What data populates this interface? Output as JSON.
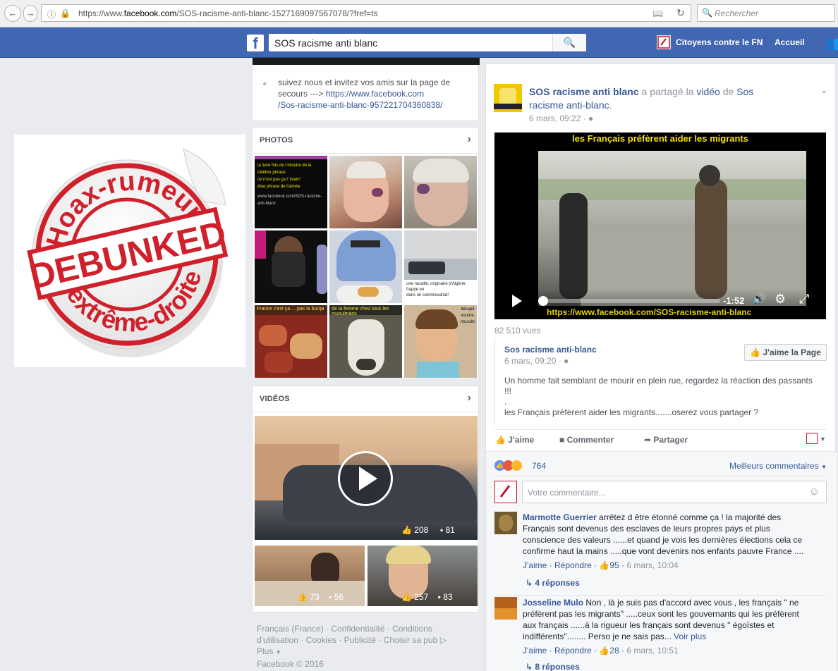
{
  "browser": {
    "url_prefix": "https://www.",
    "url_domain": "facebook.com",
    "url_path": "/SOS-racisme-anti-blanc-1527169097567078/?fref=ts",
    "search_placeholder": "Rechercher"
  },
  "header": {
    "search_value": "SOS racisme anti blanc",
    "page_link": "Citoyens contre le FN",
    "home_link": "Accueil"
  },
  "left": {
    "about_text_1": "suivez nous et invitez vos amis sur la page de",
    "about_text_2": "secours --->",
    "about_link_1": "https://www.facebook.com",
    "about_link_2": "/Sos-racisme-anti-blanc-957221704360838/",
    "photos_title": "PHOTOS",
    "videos_title": "VIDÉOS",
    "main_video": {
      "likes": "208",
      "comments": "81"
    },
    "small_videos": [
      {
        "likes": "73",
        "comments": "56"
      },
      {
        "likes": "257",
        "comments": "83"
      }
    ],
    "photo_captions": {
      "p1_line1": "la 1ere fois de l histoire de la",
      "p1_line2": "célèbre phrase",
      "p1_line3": "ce n'est pas ça l' islam\"",
      "p1_line4": "élue phrase de l'année",
      "p1_line5": "www.facebook.com/SOS-racisme-anti-blanc",
      "p7_line1": "France c'est ça ....pas la burqa",
      "p8_line1": "de la femme chez tous les musulmans",
      "p9_line1": "décapit",
      "p9_line2": "nourrie",
      "p9_line3": "musulm",
      "p6_line1": "une racaille, originaire d'Algérie, frappe en",
      "p6_line2": "dans un commissariat!"
    },
    "debunk": {
      "top": "Hoax-rumeurs",
      "middle": "DEBUNKED",
      "bottom": "d'extrême-droite"
    }
  },
  "footer": {
    "line1": "Français (France) · Confidentialité · Conditions",
    "line2": "d'utilisation · Cookies · Publicité · Choisir sa pub",
    "line3": "Plus",
    "line4": "Facebook © 2016"
  },
  "post": {
    "author": "SOS racisme anti blanc",
    "action_1": "a partagé la",
    "action_link": "vidéo",
    "action_2": "de",
    "source": "Sos",
    "source_2": "racisme anti-blanc",
    "time": "6 mars, 09:22",
    "video_caption": "les  Français préfèrent aider les migrants",
    "video_url_overlay": "https://www.facebook.com/SOS-racisme-anti-blanc",
    "video_time": "-1:52",
    "views": "82 510 vues",
    "shared_author": "Sos racisme anti-blanc",
    "shared_time": "6 mars, 09:20",
    "like_page_button": "J'aime la Page",
    "text_line1": "Un homme fait semblant de mourir en plein rue, regardez la réaction des passants",
    "text_line2": "!!!",
    "text_line3": ".",
    "text_line4": "les Français préfèrent aider les migrants.......oserez vous partager ?",
    "actions": {
      "like": "J'aime",
      "comment": "Commenter",
      "share": "Partager"
    },
    "reactions_count": "764",
    "sort_label": "Meilleurs commentaires",
    "comment_placeholder": "Votre commentaire..."
  },
  "comments": [
    {
      "name": "Marmotte Guerrier",
      "line1": "arrêtez d être étonné comme ça ! la majorité des",
      "line2": "Français sont devenus des esclaves de leurs propres pays et plus",
      "line3": "conscience des valeurs ......et quand je vois les dernières élections cela ce",
      "line4": "confirme haut la mains .....que vont devenirs nos enfants pauvre France ....",
      "like": "J'aime",
      "reply": "Répondre",
      "likes": "95",
      "time": "6 mars, 10:04",
      "replies": "4 réponses"
    },
    {
      "name": "Josseline Mulo",
      "line1": "Non , là je suis pas d'accord avec vous , les français \" ne",
      "line2": "préfèrent pas les migrants\" .....ceux sont les gouvernants qui les préfèrent",
      "line3": "aux français ......à la rigueur les français sont devenus \" égoïstes et",
      "line4": "indifférents\"........ Perso je ne sais pas...",
      "see_more": "Voir plus",
      "like": "J'aime",
      "reply": "Répondre",
      "likes": "28",
      "time": "6 mars, 10:51",
      "replies": "8 réponses"
    }
  ],
  "colors": {
    "fb_blue": "#4267b2",
    "link": "#365899",
    "debunk_red": "#d0202b"
  }
}
